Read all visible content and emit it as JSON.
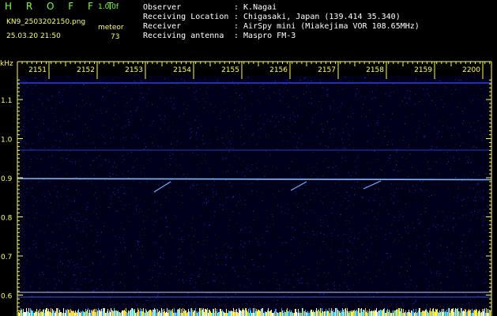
{
  "header": {
    "app_name": "H R O F F T",
    "version": "1.0.0f",
    "filename": "KN9_2503202150.png",
    "meteor_label": "meteor",
    "datetime": "25.03.20 21:50",
    "meteor_count": "73"
  },
  "info": {
    "rows": [
      {
        "label": "Observer",
        "value": ": K.Nagai"
      },
      {
        "label": "Receiving Location",
        "value": ": Chigasaki, Japan (139.414 35.340)"
      },
      {
        "label": "Receiver",
        "value": ": AirSpy mini (Miakejima VOR 108.65MHz)"
      },
      {
        "label": "Receiving antenna",
        "value": ": Maspro FM-3"
      }
    ]
  },
  "spectrogram": {
    "y_unit": "kHz",
    "time_ticks": [
      "2151",
      "2152",
      "2153",
      "2154",
      "2155",
      "2156",
      "2157",
      "2158",
      "2159",
      "2200"
    ],
    "freq_ticks": [
      "1.1",
      "1.0",
      "0.9",
      "0.8",
      "0.7",
      "0.6"
    ],
    "carrier_khz": 0.91,
    "colors": {
      "background": "#000022",
      "noise": "#1a2ad8",
      "carrier": "#7ab8ff",
      "axis": "#ffff40",
      "meteor": "#6fb0ff"
    }
  }
}
